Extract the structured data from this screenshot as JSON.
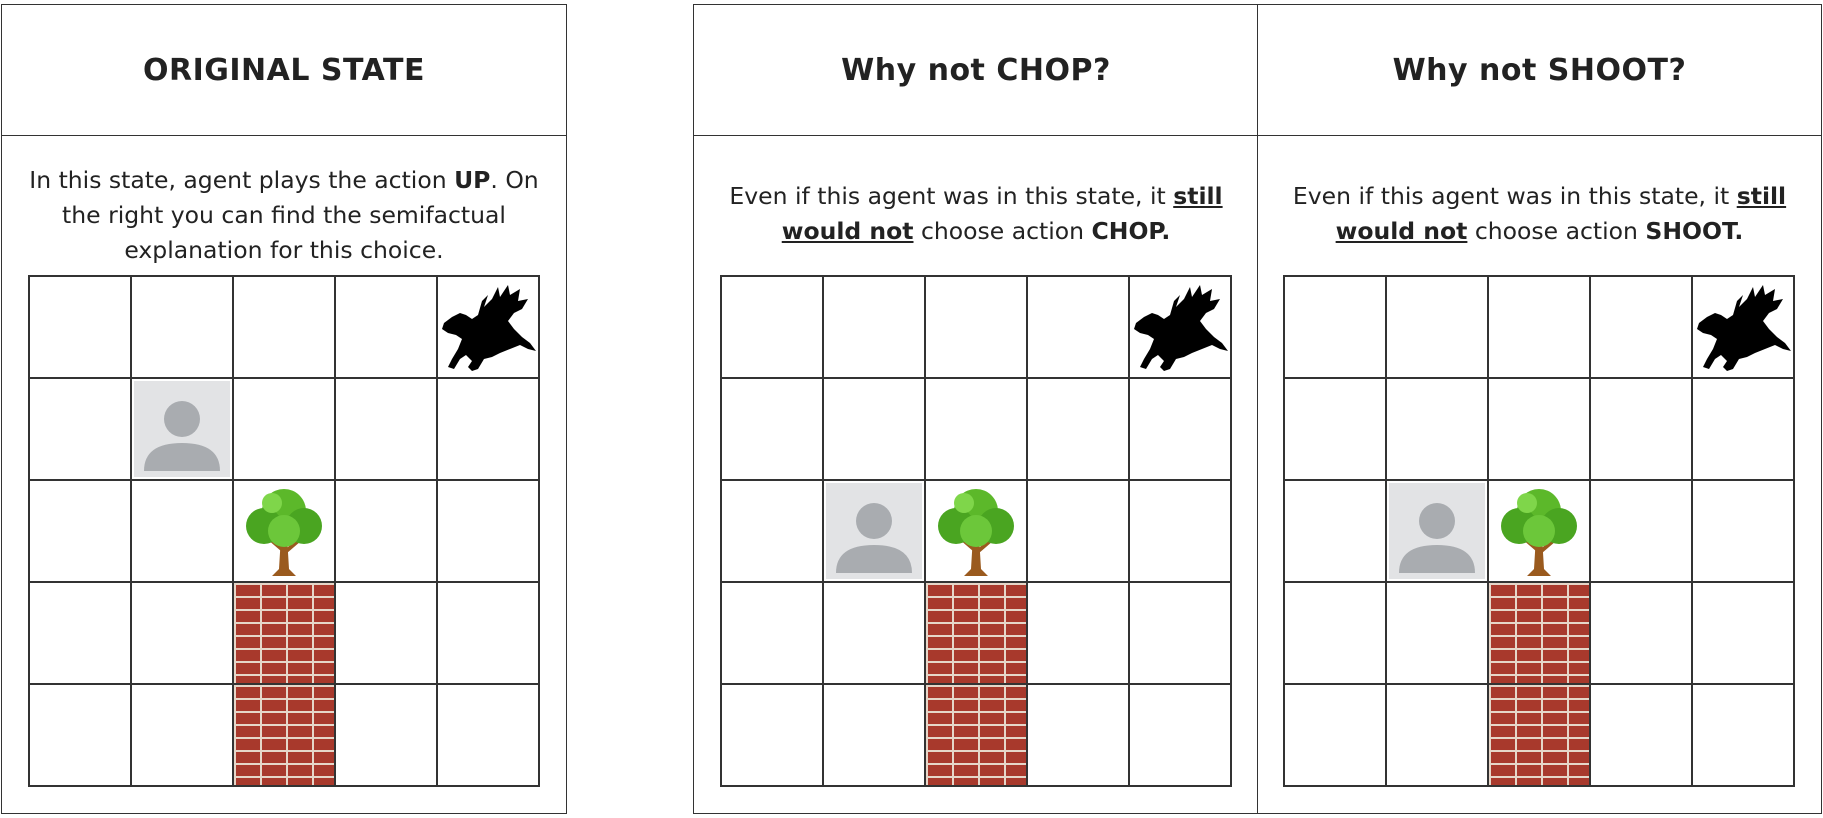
{
  "panels": [
    {
      "title": "ORIGINAL STATE",
      "desc": {
        "p1": "In this state, agent plays the action ",
        "b1": "UP",
        "p2": ". On the right you can find the semifactual explanation for this choice."
      },
      "grid": {
        "agent": [
          1,
          1
        ],
        "dragon": [
          0,
          4
        ],
        "tree": [
          2,
          2
        ],
        "walls": [
          [
            3,
            2
          ],
          [
            4,
            2
          ]
        ]
      }
    },
    {
      "title": "Why not CHOP?",
      "desc": {
        "p1": "Even if this agent was in this state, it ",
        "u1": "still would not",
        "p2": " choose action ",
        "b1": "CHOP."
      },
      "grid": {
        "agent": [
          2,
          1
        ],
        "dragon": [
          0,
          4
        ],
        "tree": [
          2,
          2
        ],
        "walls": [
          [
            3,
            2
          ],
          [
            4,
            2
          ]
        ]
      }
    },
    {
      "title": "Why not SHOOT?",
      "desc": {
        "p1": "Even if this agent was in this state, it ",
        "u1": "still would not",
        "p2": " choose action ",
        "b1": "SHOOT."
      },
      "grid": {
        "agent": [
          2,
          1
        ],
        "dragon": [
          0,
          4
        ],
        "tree": [
          2,
          2
        ],
        "walls": [
          [
            3,
            2
          ],
          [
            4,
            2
          ]
        ]
      }
    }
  ],
  "icons": {
    "agent": "person-placeholder-icon",
    "dragon": "dragon-silhouette-icon",
    "tree": "tree-icon",
    "wall": "brick-wall-tile"
  },
  "colors": {
    "border": "#333333",
    "brick": "#a8392c",
    "agent_bg": "#e2e3e5",
    "agent_fg": "#a9acb0",
    "tree_green": "#5cb82a",
    "trunk": "#9a5a1e"
  }
}
